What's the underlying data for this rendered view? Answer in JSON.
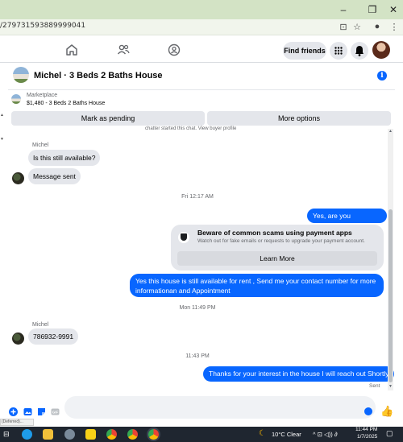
{
  "browser": {
    "url": "/279731593889999041",
    "window_buttons": [
      "–",
      "❐",
      "✕"
    ],
    "address_icons": [
      "cast-icon",
      "bookmark-star-icon",
      "profile-icon",
      "kebab-menu-icon"
    ]
  },
  "fbnav": {
    "icons": [
      "home-icon",
      "friends-icon",
      "groups-icon"
    ],
    "find_friends": "Find friends",
    "right_icons": [
      "menu-grid-icon",
      "notifications-icon",
      "profile-avatar"
    ]
  },
  "chat": {
    "title": "Michel · 3 Beds 2 Baths House",
    "marketplace_label": "Marketplace",
    "listing": "$1,480 - 3 Beds 2 Baths House",
    "mark_pending": "Mark as pending",
    "more_options": "More options",
    "cut_text": "chatter started this chat. View buyer profile"
  },
  "messages": {
    "sender1": "Michel",
    "m1": "Is this still available?",
    "m2": "Message sent",
    "time1": "Fri 12:17 AM",
    "out1": "Yes, are you interested?",
    "scam_title": "Beware of common scams using payment apps",
    "scam_sub": "Watch out for fake emails or requests to upgrade your payment account.",
    "learn_more": "Learn More",
    "out2": "Yes this house is still available for rent , Send me your contact number for more informationan and Appointment",
    "time2": "Mon 11:49 PM",
    "sender2": "Michel",
    "m3": "786932-9991",
    "time3": "11:43 PM",
    "out3": "Thanks for your interest in the house I will reach out Shortly",
    "sent": "Sent"
  },
  "composer": {
    "status_url": "(Deferred)..."
  },
  "taskbar": {
    "weather": "10°C  Clear",
    "time": "11:44 PM",
    "date": "1/7/2025",
    "tray": "^ ⊡ ◁)) ∂"
  },
  "colors": {
    "accent": "#0866ff",
    "bubble_in": "#e4e6eb",
    "taskbar": "#1f2630",
    "titlebar": "#d3e3c5"
  }
}
